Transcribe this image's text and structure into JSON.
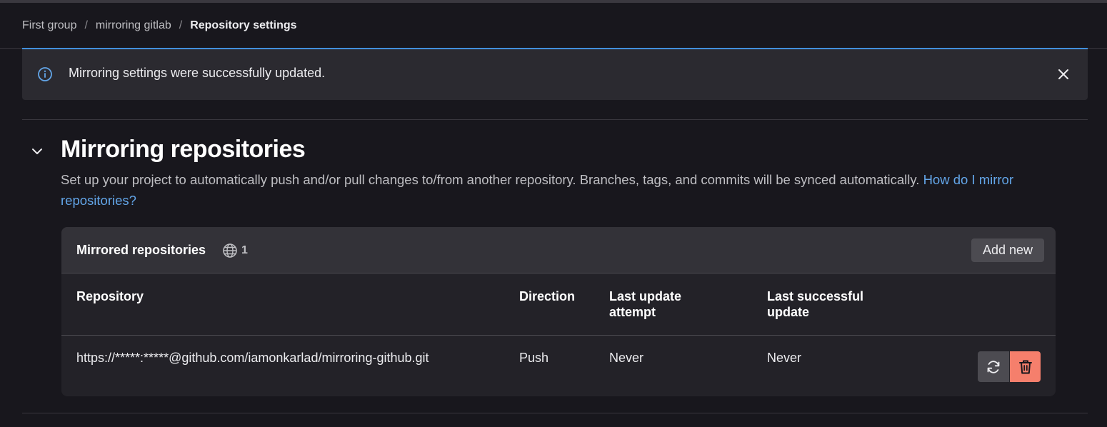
{
  "breadcrumb": {
    "items": [
      "First group",
      "mirroring gitlab",
      "Repository settings"
    ],
    "separator": "/"
  },
  "alert": {
    "message": "Mirroring settings were successfully updated.",
    "icon": "info-icon",
    "close_icon": "close-icon"
  },
  "section": {
    "title": "Mirroring repositories",
    "description": "Set up your project to automatically push and/or pull changes to/from another repository. Branches, tags, and commits will be synced automatically.",
    "help_link": "How do I mirror repositories?"
  },
  "mirrored": {
    "title": "Mirrored repositories",
    "count": "1",
    "add_button": "Add new",
    "columns": {
      "repository": "Repository",
      "direction": "Direction",
      "last_attempt": "Last update attempt",
      "last_success": "Last successful update"
    },
    "rows": [
      {
        "repository": "https://*****:*****@github.com/iamonkarlad/mirroring-github.git",
        "direction": "Push",
        "last_attempt": "Never",
        "last_success": "Never"
      }
    ]
  },
  "colors": {
    "background": "#18171d",
    "card": "#232228",
    "card_header": "#333238",
    "link": "#63a6e9",
    "accent": "#428fdc",
    "danger": "#f57f6c"
  }
}
